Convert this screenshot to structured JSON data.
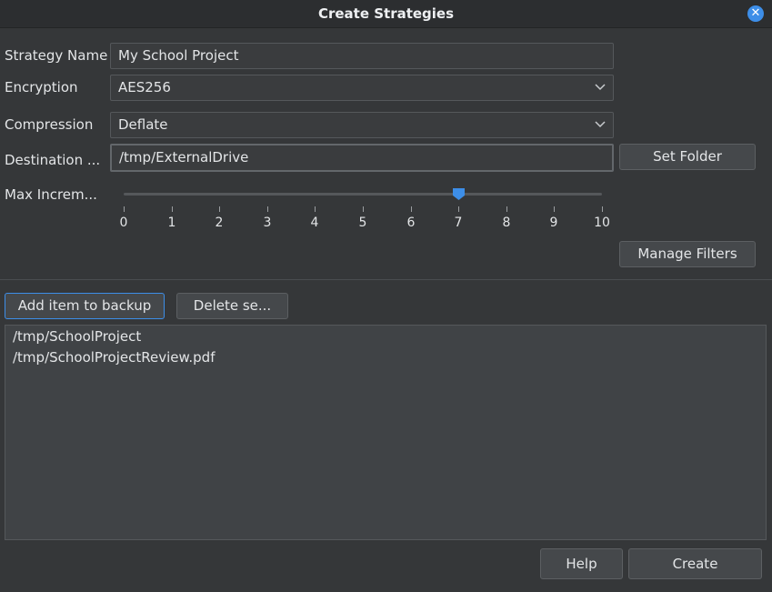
{
  "window": {
    "title": "Create Strategies"
  },
  "form": {
    "strategy_name": {
      "label": "Strategy Name",
      "value": "My School Project"
    },
    "encryption": {
      "label": "Encryption",
      "value": "AES256"
    },
    "compression": {
      "label": "Compression",
      "value": "Deflate"
    },
    "destination": {
      "label": "Destination ...",
      "value": "/tmp/ExternalDrive",
      "button": "Set Folder"
    },
    "max_increment": {
      "label": "Max Increm...",
      "value": 7,
      "min": 0,
      "max": 10,
      "ticks": [
        "0",
        "1",
        "2",
        "3",
        "4",
        "5",
        "6",
        "7",
        "8",
        "9",
        "10"
      ]
    },
    "manage_filters": "Manage Filters"
  },
  "backup": {
    "add_button": "Add item to backup",
    "delete_button": "Delete se...",
    "items": [
      "/tmp/SchoolProject",
      "/tmp/SchoolProjectReview.pdf"
    ]
  },
  "footer": {
    "help": "Help",
    "create": "Create"
  },
  "colors": {
    "accent": "#3d8ee8",
    "background": "#353739"
  }
}
